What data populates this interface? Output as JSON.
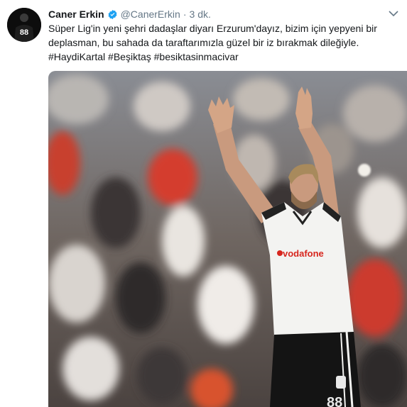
{
  "tweet": {
    "author_name": "Caner Erkin",
    "author_handle": "@CanerErkin",
    "separator": "·",
    "timestamp": "3 dk.",
    "text_line1": "Süper Lig'in yeni şehri dadaşlar diyarı Erzurum'dayız, bizim için yepyeni bir",
    "text_line2": "deplasman, bu sahada da taraftarımızla güzel bir iz bırakmak dileğiyle.",
    "hashtags": [
      "#HaydiKartal",
      "#Beşiktaş",
      "#besiktasinmacivar"
    ],
    "avatar_number": "88",
    "icons": {
      "verified": "verified-badge-icon",
      "menu": "chevron-down-icon"
    },
    "media": {
      "shirt_sponsor": "vodafone",
      "shorts_number": "88"
    }
  },
  "colors": {
    "name": "#14171a",
    "secondary": "#657786",
    "verified": "#1da1f2"
  }
}
